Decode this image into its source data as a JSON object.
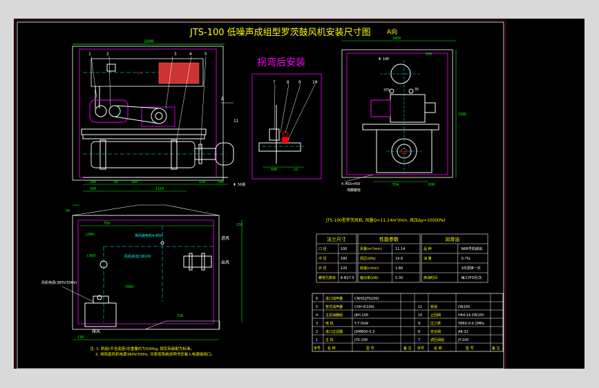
{
  "drawing": {
    "title": "JTS-100 低噪声成组型罗茨鼓风机安装尺寸图",
    "view_a_label": "A向",
    "bend_install": "拐弯后安装",
    "section_mark": "A",
    "callouts": [
      "1",
      "2",
      "3",
      "4",
      "5",
      "11",
      "7",
      "8",
      "9",
      "10"
    ],
    "dims_main": {
      "top": "1600",
      "bottom": "1310",
      "b1": "390",
      "b2": "60",
      "b3": "160",
      "b4": "150",
      "b5": "500",
      "dia": "Φ 50通",
      "left": "390"
    },
    "dims_bend": {
      "d1": "500",
      "d2": "22"
    },
    "dims_a": {
      "top": "1050",
      "w1": "550",
      "h1": "1560",
      "base": "554",
      "w2": "630",
      "bolt": "4-M16×450",
      "bolt2": "地脚螺栓",
      "phi": "Φ 100",
      "d375": "375",
      "d35": "35"
    },
    "plan_dims": {
      "p1": "50",
      "p2": "750",
      "p3": "(200)",
      "p4": "150",
      "p5": "720",
      "p6": "110",
      "p7": "(500)",
      "p8": "(360)"
    },
    "plan_labels": {
      "a": "排风扇电机4-Φ50",
      "b": "风机进出口Φ100",
      "c": "进风",
      "d": "出风",
      "e": "风机电源(380V/50Hz)",
      "f": "排风"
    },
    "note_header": "JTS-100型罗茨风机, 风量Q=11.14m³/min, 风压Δp=100(kPa)",
    "notes": [
      "注: 1. 机组(不含底座)总重量约为500kg, 按实际装配为标准。",
      "2. 排风扇风机电源380V/50Hz, 功率按系统说明书安装入电源接线口。"
    ]
  },
  "spec_tables": {
    "t1": {
      "title": "法兰尺寸",
      "rows": [
        [
          "口  径",
          "100"
        ],
        [
          "中  径",
          "180"
        ],
        [
          "外  径",
          "220"
        ],
        [
          "螺栓孔数目",
          "8-Φ17.5"
        ]
      ]
    },
    "t2": {
      "title": "性能参数",
      "rows": [
        [
          "风量(m³/min)",
          "11.14"
        ],
        [
          "风压(kPa)",
          "19.6"
        ],
        [
          "转速(r/min)",
          "1.80"
        ],
        [
          "轴功率(kW)",
          "5.30"
        ]
      ]
    },
    "t3": {
      "title": "润滑油",
      "rows": [
        [
          "品  种",
          "N68号机械油"
        ],
        [
          "油  量",
          "0.75L"
        ],
        [
          "",
          "3月更换一次"
        ],
        [
          "换油时间",
          "每工作3月/次"
        ]
      ]
    }
  },
  "bom": {
    "left": [
      [
        "6",
        "进口消声器",
        "CNHZ(JTS100)",
        "",
        ""
      ],
      [
        "5",
        "管式消声器",
        "CXH-II(100)",
        "",
        ""
      ],
      [
        "4",
        "主滤油器组",
        "JRH-100",
        "",
        ""
      ],
      [
        "3",
        "电  机",
        "Y-7.5kW",
        "",
        ""
      ],
      [
        "2",
        "进口过滤器",
        "JDMB00-0.3",
        "",
        ""
      ],
      [
        "1",
        "主  机",
        "JTS-100",
        "",
        ""
      ]
    ],
    "right": [
      [
        "11",
        "管道",
        "DN100"
      ],
      [
        "10",
        "止回阀",
        "H44-16 DN100"
      ],
      [
        "9",
        "压力表",
        "YB60-0-0.1MPa"
      ],
      [
        "8",
        "安全阀",
        "A8-32"
      ],
      [
        "7",
        "调压阀组",
        "JY-100"
      ]
    ],
    "footer": [
      "序号",
      "名  称",
      "型  号",
      "",
      "备  注"
    ],
    "footer_right": [
      "序号",
      "名  称",
      "型  号",
      "备  注"
    ]
  }
}
